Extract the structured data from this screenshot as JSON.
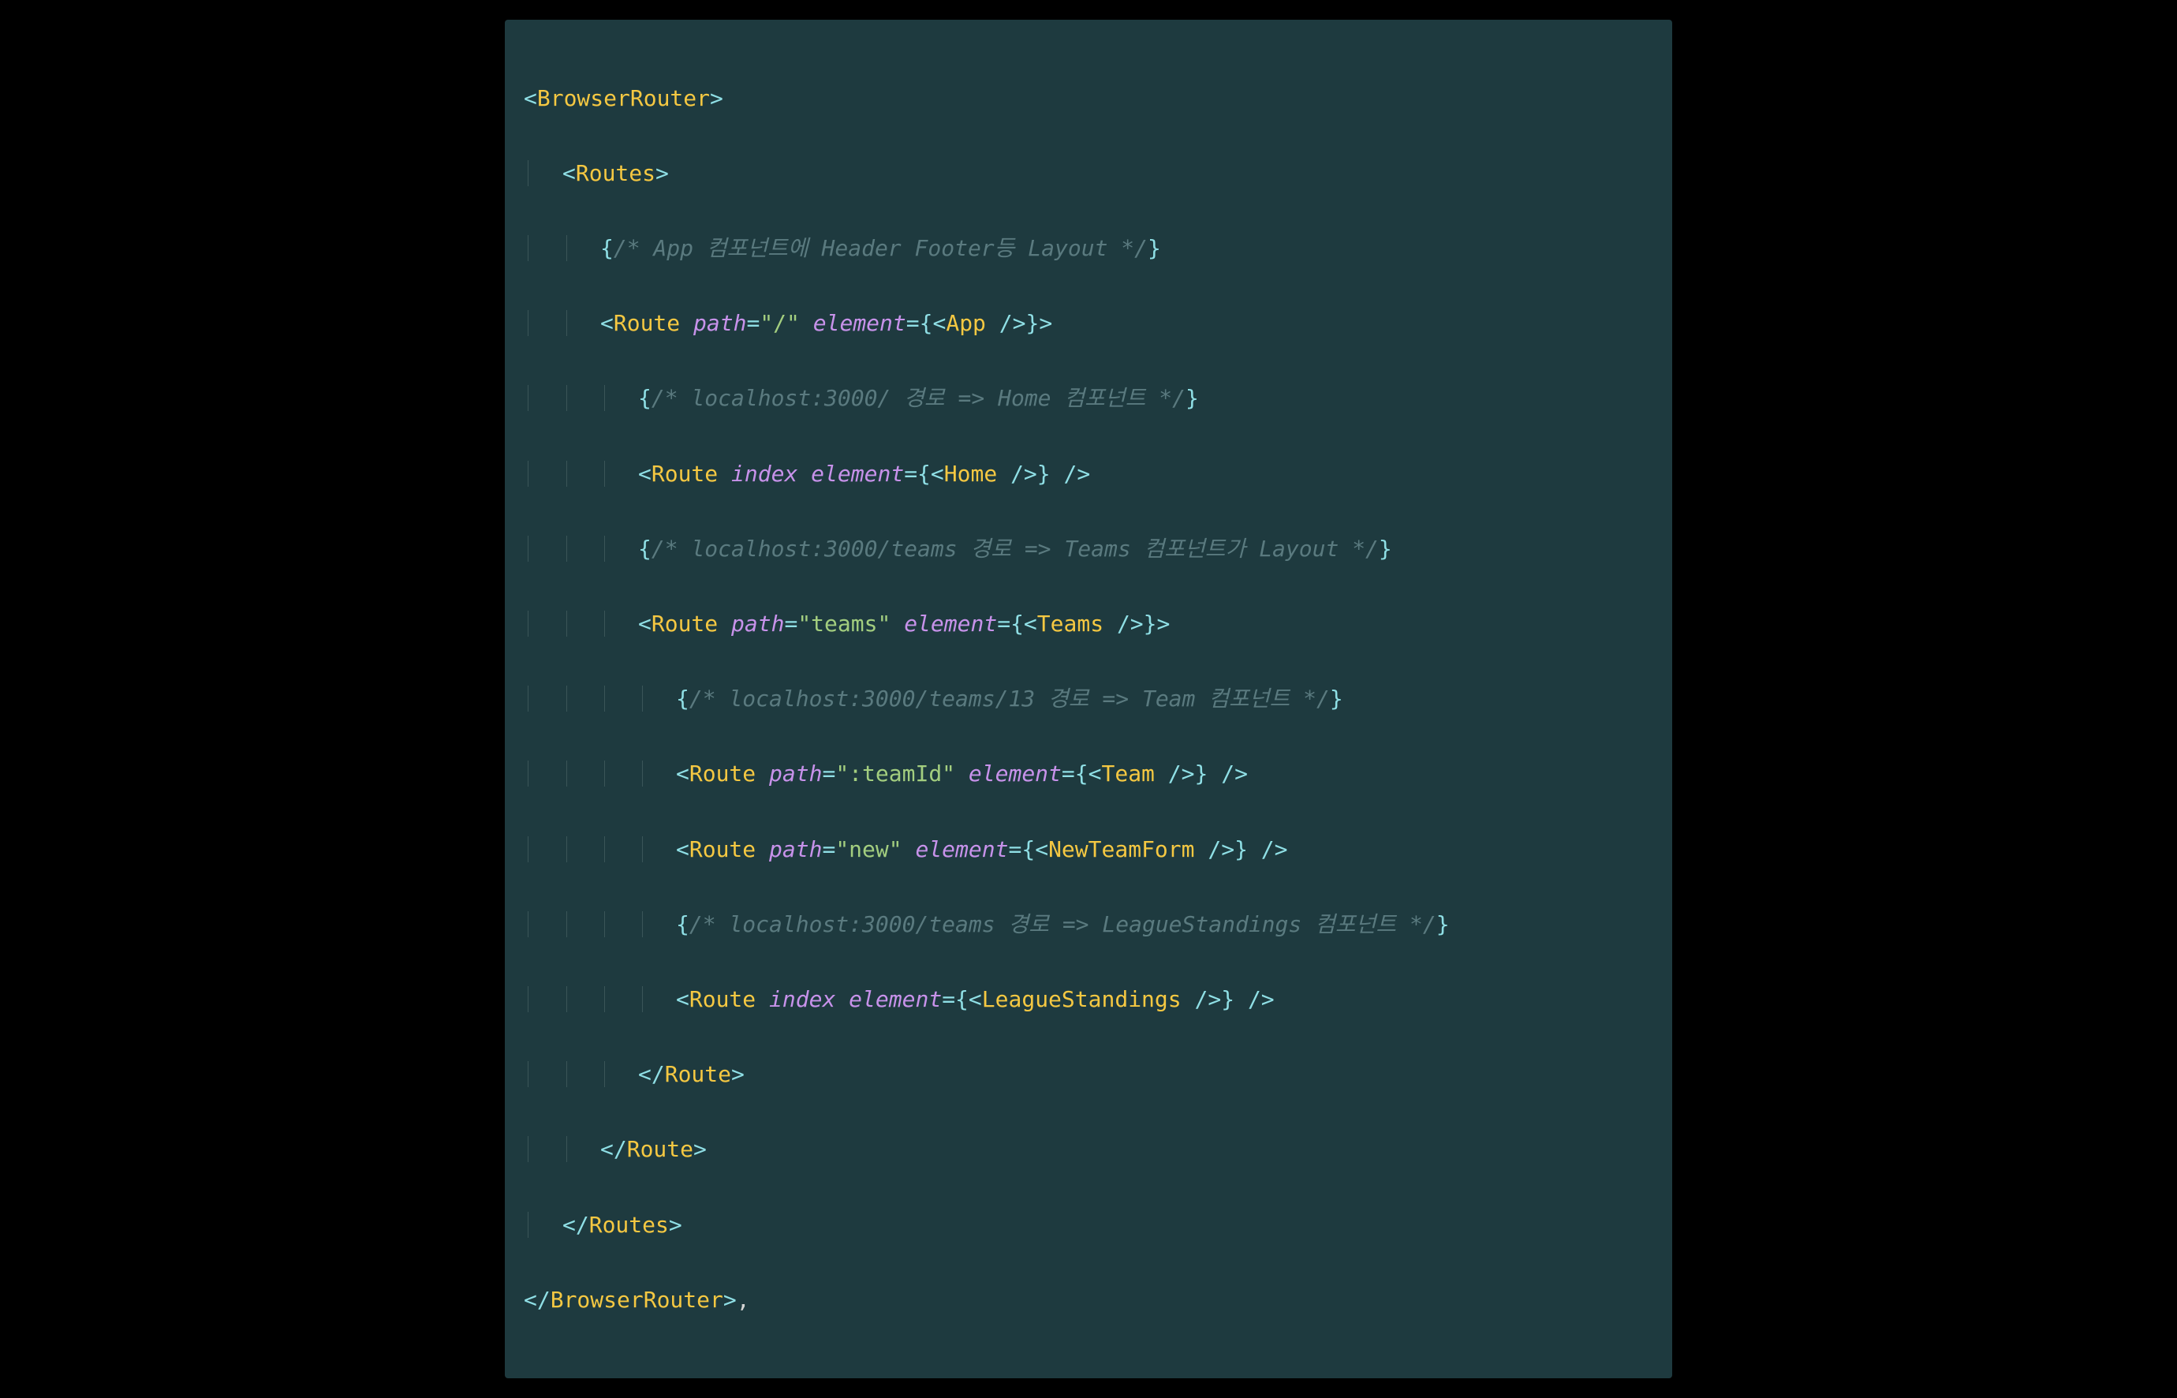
{
  "code": {
    "tags": {
      "BrowserRouter": "BrowserRouter",
      "Routes": "Routes",
      "Route": "Route",
      "App": "App",
      "Home": "Home",
      "Teams": "Teams",
      "Team": "Team",
      "NewTeamForm": "NewTeamForm",
      "LeagueStandings": "LeagueStandings"
    },
    "attrs": {
      "path": "path",
      "element": "element",
      "index": "index"
    },
    "strings": {
      "root": "\"/\"",
      "teams": "\"teams\"",
      "teamId": "\":teamId\"",
      "new": "\"new\""
    },
    "comments": {
      "c1": "/* App 컴포넌트에 Header Footer등 Layout */",
      "c2": "/* localhost:3000/ 경로 => Home 컴포넌트 */",
      "c3": "/* localhost:3000/teams 경로 => Teams 컴포넌트가 Layout */",
      "c4": "/* localhost:3000/teams/13 경로 => Team 컴포넌트 */",
      "c5": "/* localhost:3000/teams 경로 => LeagueStandings 컴포넌트 */"
    },
    "trailing_comma": ","
  },
  "colors": {
    "background": "#1e3a3f",
    "bracket": "#8fdfe5",
    "tag": "#f5c842",
    "attribute": "#c792ea",
    "string": "#a3ce7f",
    "comment": "#5a7a7f",
    "guide": "#3a5558"
  }
}
